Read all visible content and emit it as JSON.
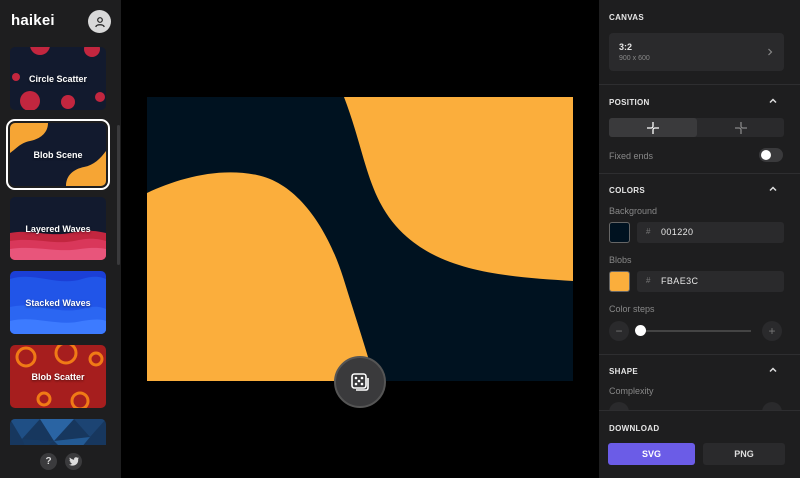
{
  "app": {
    "logo": "haikei"
  },
  "sidebar": {
    "items": [
      {
        "label": "Circle Scatter"
      },
      {
        "label": "Blob Scene"
      },
      {
        "label": "Layered Waves"
      },
      {
        "label": "Stacked Waves"
      },
      {
        "label": "Blob Scatter"
      },
      {
        "label": ""
      }
    ],
    "help_label": "?",
    "twitter_icon": "twitter-icon"
  },
  "panel": {
    "canvas": {
      "title": "CANVAS",
      "ratio": "3:2",
      "size": "900 x 600"
    },
    "position": {
      "title": "POSITION",
      "fixed_ends_label": "Fixed ends"
    },
    "colors": {
      "title": "COLORS",
      "background_label": "Background",
      "background_hex": "001220",
      "blobs_label": "Blobs",
      "blobs_hex": "FBAE3C",
      "steps_label": "Color steps",
      "minus": "−",
      "plus": "+"
    },
    "shape": {
      "title": "SHAPE",
      "complexity_label": "Complexity"
    },
    "download": {
      "title": "DOWNLOAD",
      "svg_label": "SVG",
      "png_label": "PNG"
    }
  },
  "colors": {
    "background": "#001220",
    "blob": "#FBAE3C",
    "accent": "#6b5ce7"
  }
}
